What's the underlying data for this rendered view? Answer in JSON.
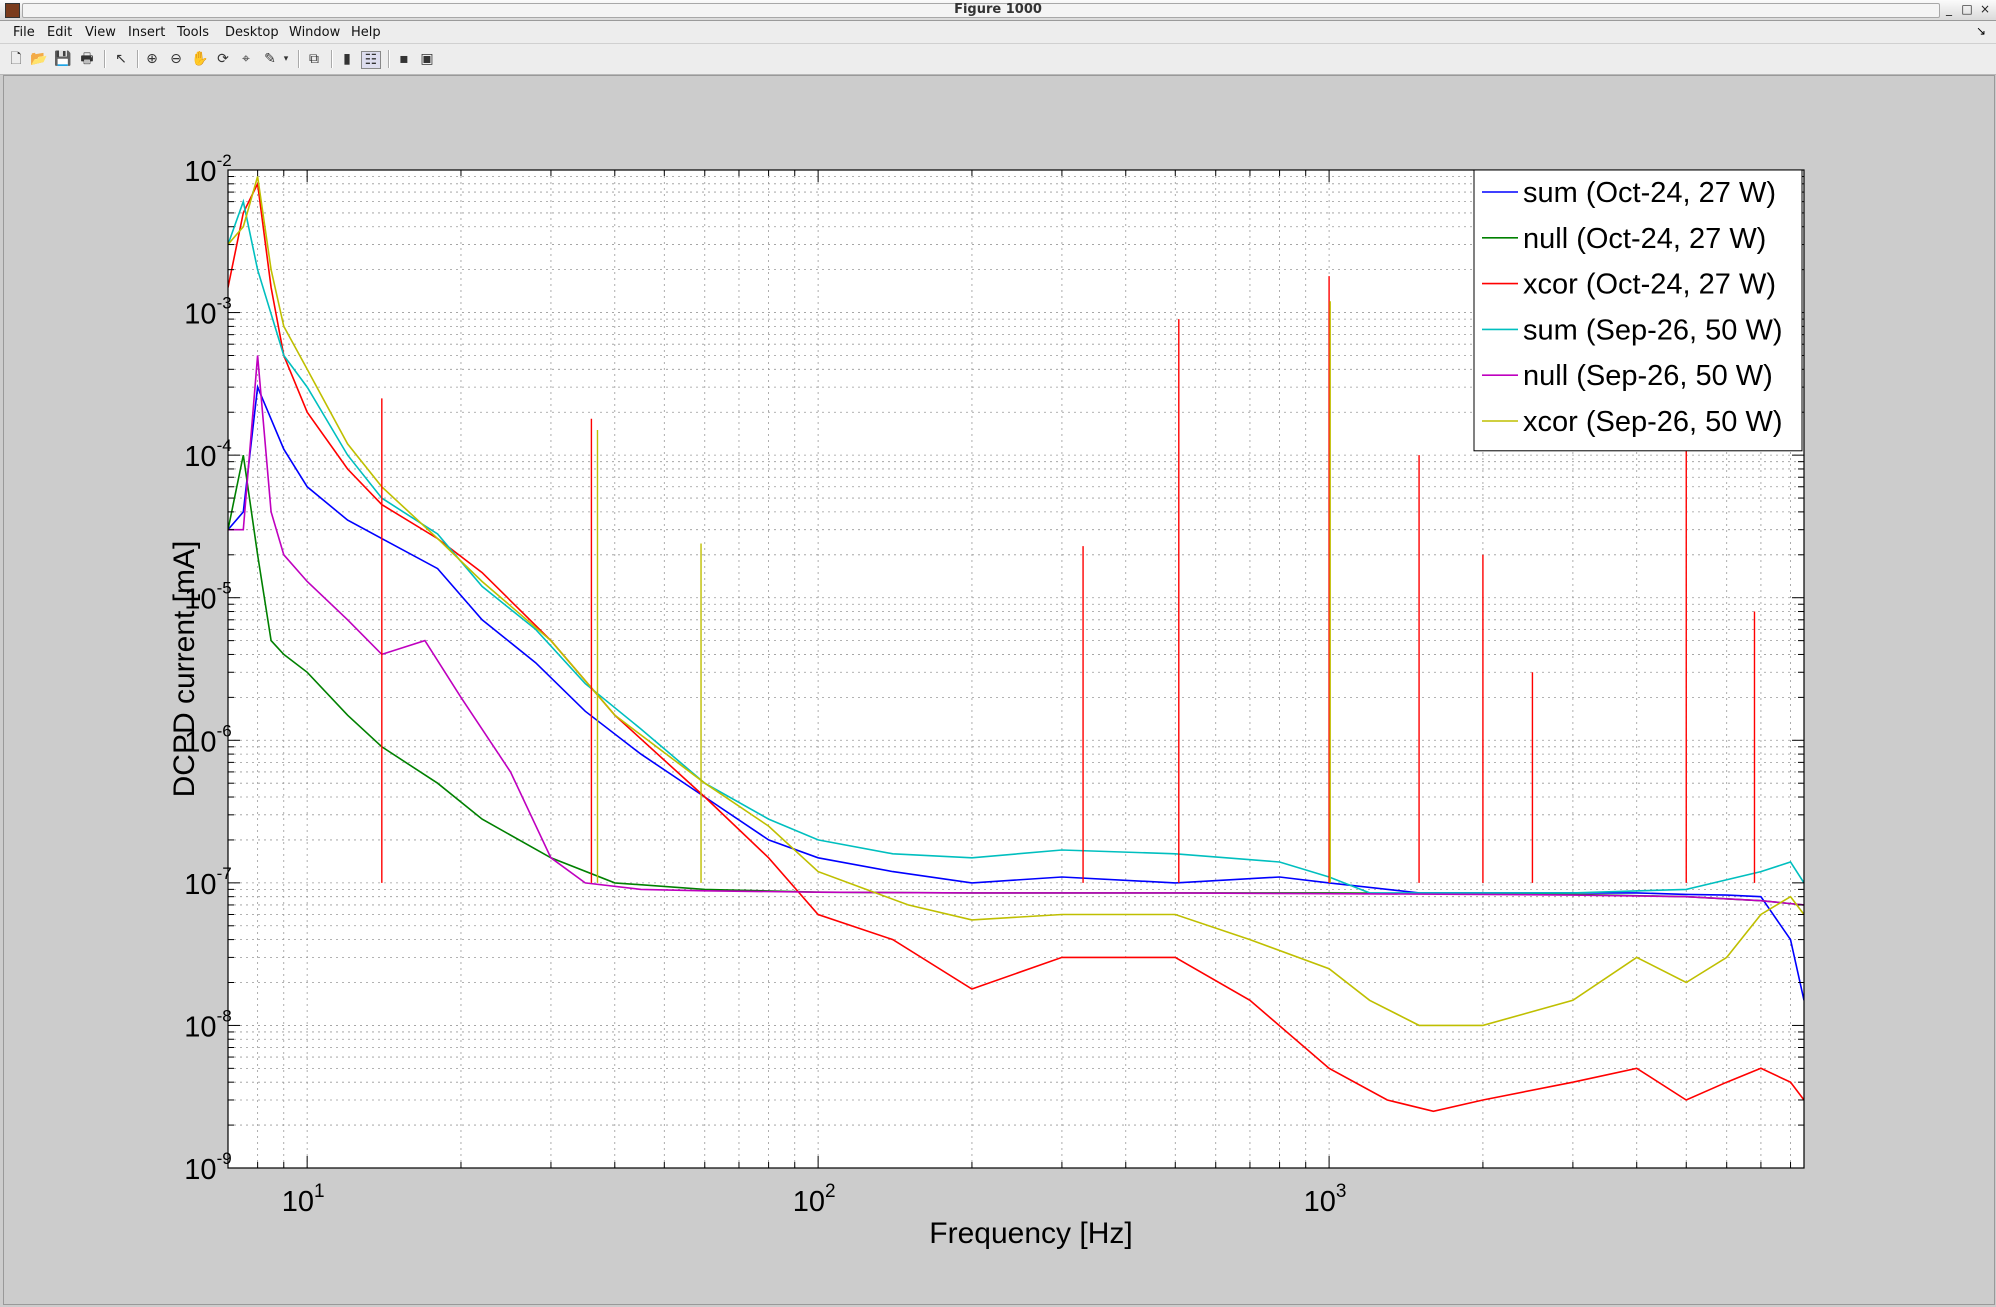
{
  "window": {
    "title": "Figure 1000",
    "controls": [
      "_",
      "□",
      "×"
    ]
  },
  "menubar": {
    "items": [
      "File",
      "Edit",
      "View",
      "Insert",
      "Tools",
      "Desktop",
      "Window",
      "Help"
    ],
    "close_arrow": "↘"
  },
  "toolbar": {
    "icons": [
      "new-figure-icon",
      "open-file-icon",
      "save-icon",
      "print-icon",
      "edit-plot-arrow-icon",
      "zoom-in-icon",
      "zoom-out-icon",
      "pan-hand-icon",
      "rotate-3d-icon",
      "data-cursor-icon",
      "brush-icon",
      "brush-dropdown-icon",
      "link-plot-icon",
      "colorbar-icon",
      "legend-icon",
      "hide-plot-tools-icon",
      "show-plot-tools-icon"
    ]
  },
  "chart_data": {
    "type": "line",
    "title": "",
    "xlabel": "Frequency [Hz]",
    "ylabel": "DCPD current [mA]",
    "xscale": "log",
    "yscale": "log",
    "xlim": [
      7,
      8500
    ],
    "ylim": [
      1e-09,
      0.01
    ],
    "grid": true,
    "minor_grid": true,
    "legend_position": "top-right",
    "x_ticks": [
      {
        "base": "10",
        "exp": "1"
      },
      {
        "base": "10",
        "exp": "2"
      },
      {
        "base": "10",
        "exp": "3"
      }
    ],
    "y_ticks": [
      {
        "base": "10",
        "exp": "-9"
      },
      {
        "base": "10",
        "exp": "-8"
      },
      {
        "base": "10",
        "exp": "-7"
      },
      {
        "base": "10",
        "exp": "-6"
      },
      {
        "base": "10",
        "exp": "-5"
      },
      {
        "base": "10",
        "exp": "-4"
      },
      {
        "base": "10",
        "exp": "-3"
      },
      {
        "base": "10",
        "exp": "-2"
      }
    ],
    "series": [
      {
        "name": "sum (Oct-24, 27 W)",
        "color": "#0000ff",
        "x": [
          7,
          7.5,
          8,
          9,
          10,
          12,
          14,
          18,
          22,
          28,
          35,
          45,
          60,
          80,
          100,
          140,
          200,
          300,
          500,
          800,
          1000,
          1500,
          2000,
          3000,
          4000,
          5000,
          6000,
          7000,
          8000,
          8500
        ],
        "y": [
          3e-05,
          4e-05,
          0.0003,
          0.00011,
          6e-05,
          3.5e-05,
          2.6e-05,
          1.6e-05,
          7e-06,
          3.5e-06,
          1.6e-06,
          8e-07,
          4e-07,
          2e-07,
          1.5e-07,
          1.2e-07,
          1e-07,
          1.1e-07,
          1e-07,
          1.1e-07,
          1e-07,
          8.5e-08,
          8.5e-08,
          8.5e-08,
          8.5e-08,
          8.3e-08,
          8.2e-08,
          8e-08,
          4e-08,
          1.5e-08
        ]
      },
      {
        "name": "null (Oct-24, 27 W)",
        "color": "#008000",
        "x": [
          7,
          7.5,
          8,
          8.5,
          9,
          10,
          12,
          14,
          18,
          22,
          30,
          40,
          60,
          100,
          200,
          500,
          1000,
          2000,
          3000,
          5000,
          7000,
          8500
        ],
        "y": [
          3e-05,
          0.0001,
          2e-05,
          5e-06,
          4e-06,
          3e-06,
          1.5e-06,
          9e-07,
          5e-07,
          2.8e-07,
          1.5e-07,
          1e-07,
          9e-08,
          8.6e-08,
          8.5e-08,
          8.5e-08,
          8.5e-08,
          8.4e-08,
          8.3e-08,
          8e-08,
          7.5e-08,
          7e-08
        ]
      },
      {
        "name": "xcor (Oct-24, 27 W)",
        "color": "#ff0000",
        "x": [
          7,
          7.5,
          8,
          8.5,
          9,
          10,
          12,
          14,
          18,
          22,
          30,
          40,
          60,
          80,
          100,
          140,
          200,
          300,
          500,
          700,
          1000,
          1300,
          1600,
          2000,
          3000,
          4000,
          5000,
          6000,
          7000,
          8000,
          8500
        ],
        "y": [
          0.0015,
          0.005,
          0.008,
          0.0015,
          0.0005,
          0.0002,
          8e-05,
          4.5e-05,
          2.6e-05,
          1.5e-05,
          5e-06,
          1.5e-06,
          4e-07,
          1.5e-07,
          6e-08,
          4e-08,
          1.8e-08,
          3e-08,
          3e-08,
          1.5e-08,
          5e-09,
          3e-09,
          2.5e-09,
          3e-09,
          4e-09,
          5e-09,
          3e-09,
          4e-09,
          5e-09,
          4e-09,
          3e-09
        ]
      },
      {
        "name": "sum (Sep-26, 50 W)",
        "color": "#00bfbf",
        "x": [
          7,
          7.5,
          8,
          9,
          10,
          12,
          14,
          18,
          22,
          28,
          35,
          45,
          60,
          80,
          100,
          140,
          200,
          300,
          500,
          800,
          1000,
          1200,
          2000,
          3000,
          5000,
          7000,
          8000,
          8500
        ],
        "y": [
          0.003,
          0.006,
          0.002,
          0.0005,
          0.0003,
          0.0001,
          5e-05,
          2.8e-05,
          1.2e-05,
          6e-06,
          2.5e-06,
          1.2e-06,
          5e-07,
          2.8e-07,
          2e-07,
          1.6e-07,
          1.5e-07,
          1.7e-07,
          1.6e-07,
          1.4e-07,
          1.1e-07,
          8.5e-08,
          8.5e-08,
          8.5e-08,
          9e-08,
          1.2e-07,
          1.4e-07,
          1e-07
        ]
      },
      {
        "name": "null (Sep-26, 50 W)",
        "color": "#bf00bf",
        "x": [
          7,
          7.5,
          8,
          8.5,
          9,
          10,
          12,
          14,
          17,
          20,
          25,
          30,
          35,
          45,
          60,
          100,
          200,
          500,
          1000,
          2000,
          3000,
          5000,
          7000,
          8500
        ],
        "y": [
          3e-05,
          3e-05,
          0.0005,
          4e-05,
          2e-05,
          1.3e-05,
          7e-06,
          4e-06,
          5e-06,
          2e-06,
          6e-07,
          1.5e-07,
          1e-07,
          9e-08,
          8.8e-08,
          8.6e-08,
          8.5e-08,
          8.5e-08,
          8.4e-08,
          8.3e-08,
          8.2e-08,
          8e-08,
          7.5e-08,
          7e-08
        ]
      },
      {
        "name": "xcor (Sep-26, 50 W)",
        "color": "#bfbf00",
        "x": [
          7,
          7.5,
          8,
          8.5,
          9,
          10,
          12,
          14,
          18,
          22,
          30,
          40,
          60,
          80,
          100,
          150,
          200,
          300,
          500,
          700,
          1000,
          1200,
          1500,
          2000,
          3000,
          4000,
          5000,
          6000,
          7000,
          8000,
          8500
        ],
        "y": [
          0.003,
          0.004,
          0.009,
          0.002,
          0.0008,
          0.0004,
          0.00012,
          6e-05,
          2.6e-05,
          1.3e-05,
          5e-06,
          1.5e-06,
          5e-07,
          2.5e-07,
          1.2e-07,
          7e-08,
          5.5e-08,
          6e-08,
          6e-08,
          4e-08,
          2.5e-08,
          1.5e-08,
          1e-08,
          1e-08,
          1.5e-08,
          3e-08,
          2e-08,
          3e-08,
          6e-08,
          8e-08,
          6e-08
        ]
      }
    ],
    "peaks": [
      {
        "x": 14,
        "y": 0.00025,
        "color": "#ff0000"
      },
      {
        "x": 36,
        "y": 0.00018,
        "color": "#ff0000"
      },
      {
        "x": 37,
        "y": 0.00015,
        "color": "#bfbf00"
      },
      {
        "x": 59,
        "y": 2.4e-05,
        "color": "#bfbf00"
      },
      {
        "x": 330,
        "y": 2.3e-05,
        "color": "#ff0000"
      },
      {
        "x": 508,
        "y": 0.0009,
        "color": "#ff0000"
      },
      {
        "x": 1000,
        "y": 0.0018,
        "color": "#ff0000"
      },
      {
        "x": 1005,
        "y": 0.0012,
        "color": "#bfbf00"
      },
      {
        "x": 1500,
        "y": 0.0001,
        "color": "#ff0000"
      },
      {
        "x": 2000,
        "y": 2e-05,
        "color": "#ff0000"
      },
      {
        "x": 2500,
        "y": 3e-06,
        "color": "#ff0000"
      },
      {
        "x": 5000,
        "y": 0.00012,
        "color": "#ff0000"
      },
      {
        "x": 6800,
        "y": 8e-06,
        "color": "#ff0000"
      }
    ]
  }
}
